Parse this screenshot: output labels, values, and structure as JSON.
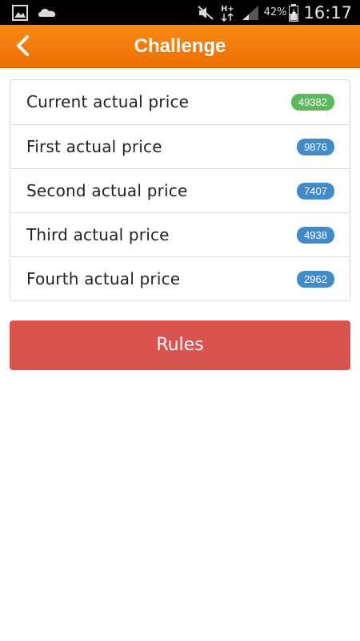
{
  "status_bar": {
    "battery_percent": "42%",
    "time": "16:17",
    "icons": [
      "gallery-icon",
      "cloud-icon",
      "mute-icon",
      "data-transfer-icon",
      "signal-icon",
      "battery-icon"
    ]
  },
  "header": {
    "title": "Challenge",
    "back_icon": "chevron-left-icon",
    "background_color": "#f27c0b"
  },
  "price_list": [
    {
      "label": "Current actual price",
      "value": "49382",
      "badge_color": "#5cb85c"
    },
    {
      "label": "First actual price",
      "value": "9876",
      "badge_color": "#428bca"
    },
    {
      "label": "Second actual price",
      "value": "7407",
      "badge_color": "#428bca"
    },
    {
      "label": "Third actual price",
      "value": "4938",
      "badge_color": "#428bca"
    },
    {
      "label": "Fourth actual price",
      "value": "2962",
      "badge_color": "#428bca"
    }
  ],
  "rules_button": {
    "label": "Rules",
    "color": "#d9534f"
  }
}
